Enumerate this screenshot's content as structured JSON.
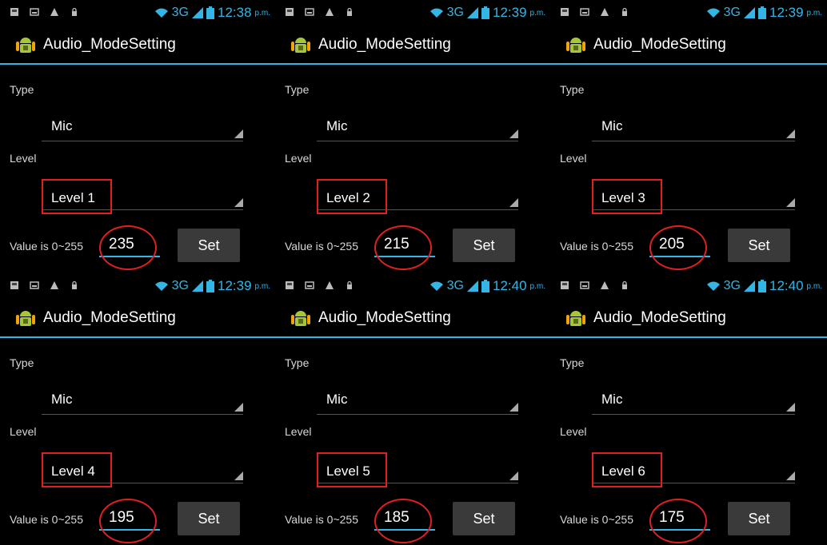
{
  "accent_color": "#33b5e5",
  "highlight_color": "#e02020",
  "status_icons": [
    "sd-card-icon",
    "image-icon",
    "warning-icon",
    "lock-icon"
  ],
  "panels": [
    {
      "time": "12:38",
      "ampm": "p.m.",
      "network": "3G",
      "app_title": "Audio_ModeSetting",
      "type_label": "Type",
      "type_value": "Mic",
      "level_label": "Level",
      "level_value": "Level 1",
      "range_label": "Value is 0~255",
      "value": "235",
      "set_label": "Set"
    },
    {
      "time": "12:39",
      "ampm": "p.m.",
      "network": "3G",
      "app_title": "Audio_ModeSetting",
      "type_label": "Type",
      "type_value": "Mic",
      "level_label": "Level",
      "level_value": "Level 2",
      "range_label": "Value is 0~255",
      "value": "215",
      "set_label": "Set"
    },
    {
      "time": "12:39",
      "ampm": "p.m.",
      "network": "3G",
      "app_title": "Audio_ModeSetting",
      "type_label": "Type",
      "type_value": "Mic",
      "level_label": "Level",
      "level_value": "Level 3",
      "range_label": "Value is 0~255",
      "value": "205",
      "set_label": "Set"
    },
    {
      "time": "12:39",
      "ampm": "p.m.",
      "network": "3G",
      "app_title": "Audio_ModeSetting",
      "type_label": "Type",
      "type_value": "Mic",
      "level_label": "Level",
      "level_value": "Level 4",
      "range_label": "Value is 0~255",
      "value": "195",
      "set_label": "Set"
    },
    {
      "time": "12:40",
      "ampm": "p.m.",
      "network": "3G",
      "app_title": "Audio_ModeSetting",
      "type_label": "Type",
      "type_value": "Mic",
      "level_label": "Level",
      "level_value": "Level 5",
      "range_label": "Value is 0~255",
      "value": "185",
      "set_label": "Set"
    },
    {
      "time": "12:40",
      "ampm": "p.m.",
      "network": "3G",
      "app_title": "Audio_ModeSetting",
      "type_label": "Type",
      "type_value": "Mic",
      "level_label": "Level",
      "level_value": "Level 6",
      "range_label": "Value is 0~255",
      "value": "175",
      "set_label": "Set"
    }
  ]
}
